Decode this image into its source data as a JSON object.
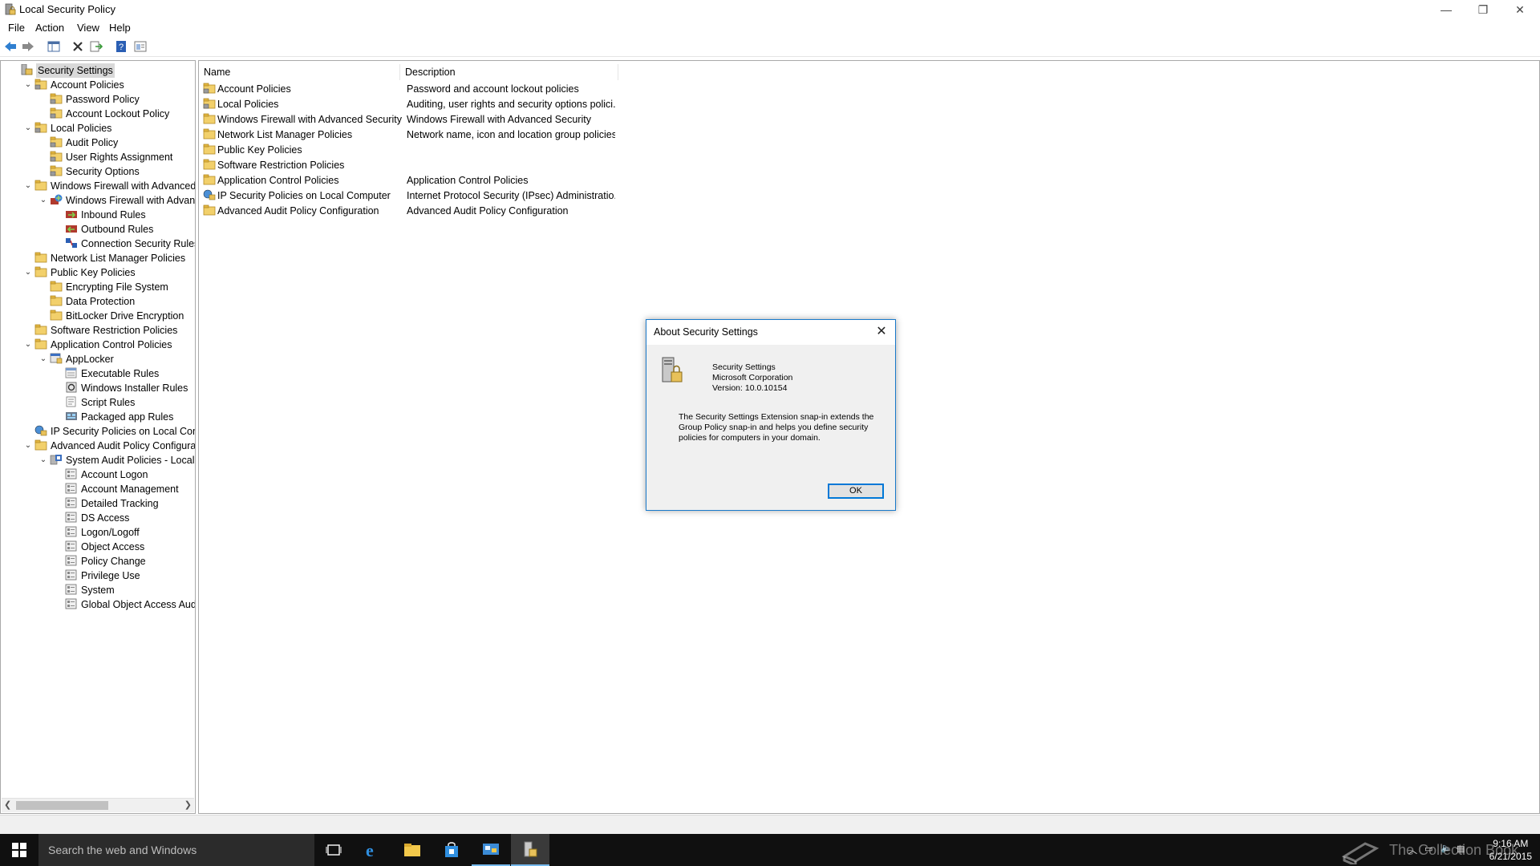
{
  "window": {
    "title": "Local Security Policy",
    "controls": {
      "minimize": "—",
      "restore": "❐",
      "close": "✕"
    }
  },
  "menu": [
    "File",
    "Action",
    "View",
    "Help"
  ],
  "tree": [
    {
      "label": "Security Settings",
      "icon": "security-settings-icon",
      "level": 0,
      "expander": "",
      "selected": true
    },
    {
      "label": "Account Policies",
      "icon": "folder-lock-icon",
      "level": 1,
      "expander": "expanded"
    },
    {
      "label": "Password Policy",
      "icon": "folder-lock-icon",
      "level": 2,
      "expander": ""
    },
    {
      "label": "Account Lockout Policy",
      "icon": "folder-lock-icon",
      "level": 2,
      "expander": ""
    },
    {
      "label": "Local Policies",
      "icon": "folder-lock-icon",
      "level": 1,
      "expander": "expanded"
    },
    {
      "label": "Audit Policy",
      "icon": "folder-lock-icon",
      "level": 2,
      "expander": ""
    },
    {
      "label": "User Rights Assignment",
      "icon": "folder-lock-icon",
      "level": 2,
      "expander": ""
    },
    {
      "label": "Security Options",
      "icon": "folder-lock-icon",
      "level": 2,
      "expander": ""
    },
    {
      "label": "Windows Firewall with Advanced Secu",
      "icon": "folder-icon",
      "level": 1,
      "expander": "expanded"
    },
    {
      "label": "Windows Firewall with Advanced",
      "icon": "firewall-icon",
      "level": 2,
      "expander": "expanded"
    },
    {
      "label": "Inbound Rules",
      "icon": "inbound-rules-icon",
      "level": 3,
      "expander": ""
    },
    {
      "label": "Outbound Rules",
      "icon": "outbound-rules-icon",
      "level": 3,
      "expander": ""
    },
    {
      "label": "Connection Security Rules",
      "icon": "connection-security-icon",
      "level": 3,
      "expander": ""
    },
    {
      "label": "Network List Manager Policies",
      "icon": "folder-icon",
      "level": 1,
      "expander": ""
    },
    {
      "label": "Public Key Policies",
      "icon": "folder-icon",
      "level": 1,
      "expander": "expanded"
    },
    {
      "label": "Encrypting File System",
      "icon": "folder-icon",
      "level": 2,
      "expander": ""
    },
    {
      "label": "Data Protection",
      "icon": "folder-icon",
      "level": 2,
      "expander": ""
    },
    {
      "label": "BitLocker Drive Encryption",
      "icon": "folder-icon",
      "level": 2,
      "expander": ""
    },
    {
      "label": "Software Restriction Policies",
      "icon": "folder-icon",
      "level": 1,
      "expander": ""
    },
    {
      "label": "Application Control Policies",
      "icon": "folder-icon",
      "level": 1,
      "expander": "expanded"
    },
    {
      "label": "AppLocker",
      "icon": "applocker-icon",
      "level": 2,
      "expander": "expanded"
    },
    {
      "label": "Executable Rules",
      "icon": "rules-icon",
      "level": 3,
      "expander": ""
    },
    {
      "label": "Windows Installer Rules",
      "icon": "installer-rules-icon",
      "level": 3,
      "expander": ""
    },
    {
      "label": "Script Rules",
      "icon": "script-rules-icon",
      "level": 3,
      "expander": ""
    },
    {
      "label": "Packaged app Rules",
      "icon": "packaged-app-rules-icon",
      "level": 3,
      "expander": ""
    },
    {
      "label": "IP Security Policies on Local Compute",
      "icon": "ip-security-icon",
      "level": 1,
      "expander": ""
    },
    {
      "label": "Advanced Audit Policy Configuration",
      "icon": "folder-icon",
      "level": 1,
      "expander": "expanded"
    },
    {
      "label": "System Audit Policies - Local Grou",
      "icon": "audit-policies-icon",
      "level": 2,
      "expander": "expanded"
    },
    {
      "label": "Account Logon",
      "icon": "audit-item-icon",
      "level": 3,
      "expander": ""
    },
    {
      "label": "Account Management",
      "icon": "audit-item-icon",
      "level": 3,
      "expander": ""
    },
    {
      "label": "Detailed Tracking",
      "icon": "audit-item-icon",
      "level": 3,
      "expander": ""
    },
    {
      "label": "DS Access",
      "icon": "audit-item-icon",
      "level": 3,
      "expander": ""
    },
    {
      "label": "Logon/Logoff",
      "icon": "audit-item-icon",
      "level": 3,
      "expander": ""
    },
    {
      "label": "Object Access",
      "icon": "audit-item-icon",
      "level": 3,
      "expander": ""
    },
    {
      "label": "Policy Change",
      "icon": "audit-item-icon",
      "level": 3,
      "expander": ""
    },
    {
      "label": "Privilege Use",
      "icon": "audit-item-icon",
      "level": 3,
      "expander": ""
    },
    {
      "label": "System",
      "icon": "audit-item-icon",
      "level": 3,
      "expander": ""
    },
    {
      "label": "Global Object Access Auditing",
      "icon": "audit-item-icon",
      "level": 3,
      "expander": ""
    }
  ],
  "list": {
    "columns": [
      "Name",
      "Description"
    ],
    "rows": [
      {
        "name": "Account Policies",
        "description": "Password and account lockout policies",
        "icon": "folder-lock-icon"
      },
      {
        "name": "Local Policies",
        "description": "Auditing, user rights and security options polici...",
        "icon": "folder-lock-icon"
      },
      {
        "name": "Windows Firewall with Advanced Security",
        "description": "Windows Firewall with Advanced Security",
        "icon": "folder-icon"
      },
      {
        "name": "Network List Manager Policies",
        "description": "Network name, icon and location group policies.",
        "icon": "folder-icon"
      },
      {
        "name": "Public Key Policies",
        "description": "",
        "icon": "folder-icon"
      },
      {
        "name": "Software Restriction Policies",
        "description": "",
        "icon": "folder-icon"
      },
      {
        "name": "Application Control Policies",
        "description": "Application Control Policies",
        "icon": "folder-icon"
      },
      {
        "name": "IP Security Policies on Local Computer",
        "description": "Internet Protocol Security (IPsec) Administratio...",
        "icon": "ip-security-icon"
      },
      {
        "name": "Advanced Audit Policy Configuration",
        "description": "Advanced Audit Policy Configuration",
        "icon": "folder-icon"
      }
    ]
  },
  "dialog": {
    "title": "About Security Settings",
    "product": "Security Settings",
    "company": "Microsoft Corporation",
    "version": "Version: 10.0.10154",
    "description": "The Security Settings Extension snap-in extends the Group Policy snap-in and helps you define security policies for computers in your domain.",
    "ok_label": "OK"
  },
  "taskbar": {
    "search_placeholder": "Search the web and Windows",
    "time": "9:16 AM",
    "date": "6/21/2015"
  },
  "watermark": "The Collection Book",
  "colors": {
    "accent": "#0078d7",
    "dialog_border": "#1979ca",
    "taskbar": "#101010",
    "folder": "#e8c15a"
  }
}
